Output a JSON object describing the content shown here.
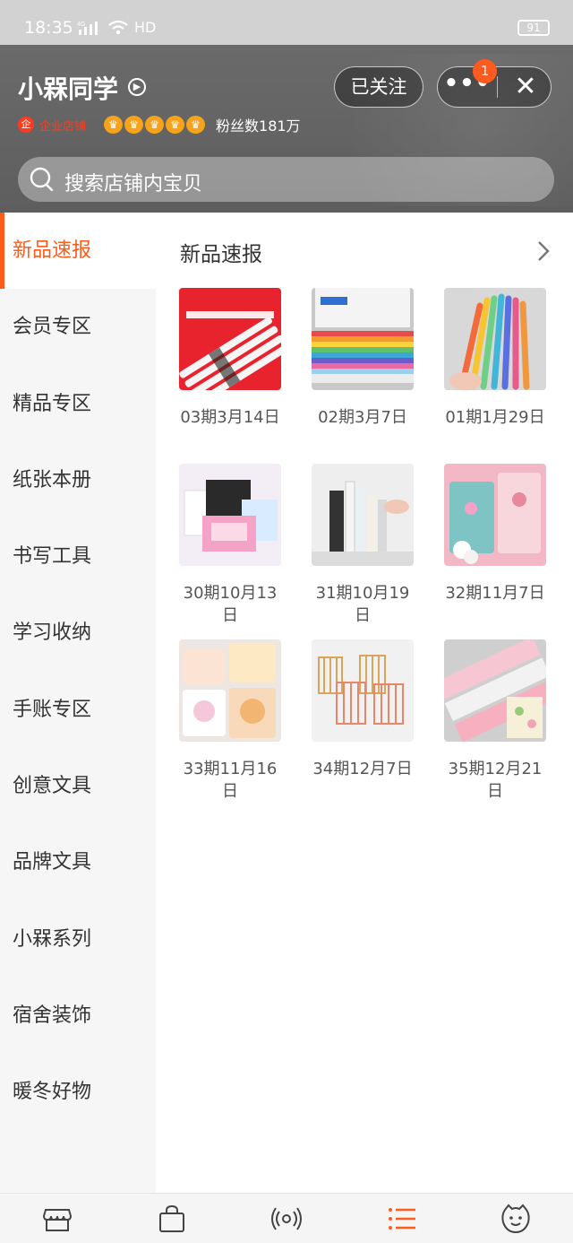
{
  "status_bar": {
    "time": "18:35",
    "network": "4G",
    "hd": "HD",
    "battery": "91"
  },
  "shop": {
    "name": "小槑同学",
    "follow_label": "已关注",
    "notification_count": "1",
    "enterprise_label": "企业店铺",
    "fans_label": "粉丝数181万",
    "search_placeholder": "搜索店铺内宝贝"
  },
  "sidebar": {
    "items": [
      {
        "label": "新品速报"
      },
      {
        "label": "会员专区"
      },
      {
        "label": "精品专区"
      },
      {
        "label": "纸张本册"
      },
      {
        "label": "书写工具"
      },
      {
        "label": "学习收纳"
      },
      {
        "label": "手账专区"
      },
      {
        "label": "创意文具"
      },
      {
        "label": "品牌文具"
      },
      {
        "label": "小槑系列"
      },
      {
        "label": "宿舍装饰"
      },
      {
        "label": "暖冬好物"
      }
    ]
  },
  "content": {
    "title": "新品速报",
    "products": [
      {
        "label": "03期3月14日"
      },
      {
        "label": "02期3月7日"
      },
      {
        "label": "01期1月29日"
      },
      {
        "label": "30期10月13日"
      },
      {
        "label": "31期10月19日"
      },
      {
        "label": "32期11月7日"
      },
      {
        "label": "33期11月16日"
      },
      {
        "label": "34期12月7日"
      },
      {
        "label": "35期12月21日"
      }
    ]
  },
  "colors": {
    "accent": "#ff5b1b",
    "header_bg": "#636363"
  }
}
